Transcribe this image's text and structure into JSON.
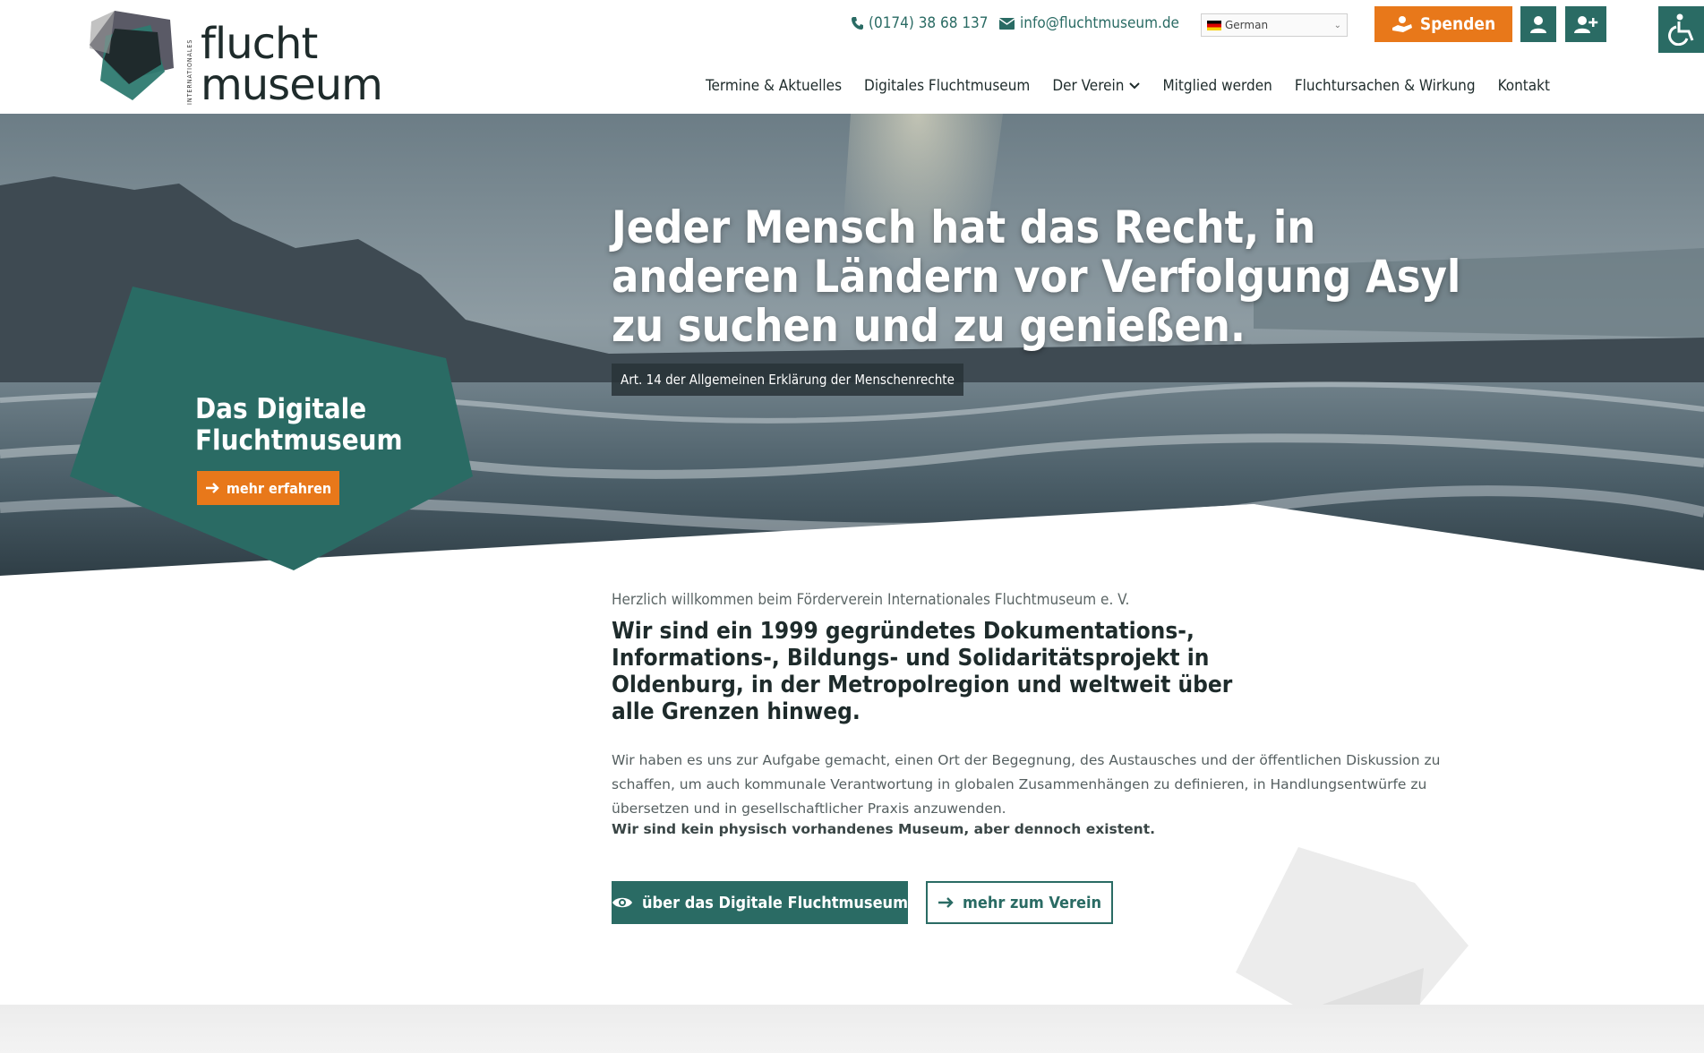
{
  "brand": {
    "name_line1": "flucht",
    "name_line2": "museum",
    "tagline_vertical": "INTERNATIONALES"
  },
  "topbar": {
    "phone": "(0174) 38 68 137",
    "email": "info@fluchtmuseum.de",
    "language": "German",
    "donate_label": "Spenden"
  },
  "icons": {
    "phone": "phone-icon",
    "email": "envelope-icon",
    "user": "user-icon",
    "add_user": "user-plus-icon",
    "accessibility": "wheelchair-icon",
    "donate": "hand-donate-icon",
    "arrow": "arrow-right-icon",
    "eye": "eye-icon"
  },
  "nav": {
    "items": [
      "Termine & Aktuelles",
      "Digitales Fluchtmuseum",
      "Der Verein",
      "Mitglied werden",
      "Fluchtursachen & Wirkung",
      "Kontakt"
    ]
  },
  "hero": {
    "quote": "Jeder Mensch hat das Recht, in anderen Ländern vor Verfolgung Asyl zu suchen und zu genießen.",
    "source": "Art. 14 der Allgemeinen Erklärung der Menschenrechte",
    "teaser_title": "Das Digitale Fluchtmuseum",
    "teaser_button": "mehr erfahren"
  },
  "content": {
    "welcome": "Herzlich willkommen beim Förderverein Internationales Fluchtmuseum e. V.",
    "lead": "Wir sind ein 1999 gegründetes Dokumentations-, Informations-, Bildungs- und Solidaritätsprojekt in Oldenburg, in der Metropolregion und weltweit über alle Grenzen hinweg.",
    "body": "Wir haben es uns zur Aufgabe gemacht, einen Ort der Begegnung, des Austausches und der öffentlichen Diskussion zu schaffen, um auch kommunale Verantwortung in globalen Zusammenhängen zu definieren, in Handlungsentwürfe zu übersetzen und in gesellschaftlicher Praxis anzuwenden.",
    "body_strong": "Wir sind kein physisch vorhandenes Museum, aber dennoch existent.",
    "button_primary": "über das Digitale Fluchtmuseum",
    "button_secondary": "mehr zum Verein"
  },
  "colors": {
    "teal": "#2a6b64",
    "orange": "#e8781a",
    "dark": "#1e2b2b"
  }
}
